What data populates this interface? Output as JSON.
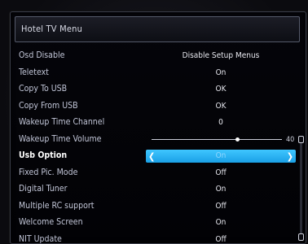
{
  "menu": {
    "title": "Hotel TV Menu",
    "items": [
      {
        "label": "Osd Disable",
        "value": "Disable Setup Menus"
      },
      {
        "label": "Teletext",
        "value": "On"
      },
      {
        "label": "Copy To USB",
        "value": "OK"
      },
      {
        "label": "Copy From USB",
        "value": "OK"
      },
      {
        "label": "Wakeup Time Channel",
        "value": "0"
      },
      {
        "label": "Wakeup Time Volume",
        "value": "40",
        "level": 0.66
      },
      {
        "label": "Usb Option",
        "value": "On",
        "selected": true
      },
      {
        "label": "Fixed Pic. Mode",
        "value": "Off"
      },
      {
        "label": "Digital Tuner",
        "value": "On"
      },
      {
        "label": "Multiple RC support",
        "value": "Off"
      },
      {
        "label": "Welcome Screen",
        "value": "On"
      },
      {
        "label": "NIT Update",
        "value": "Off"
      }
    ]
  },
  "colors": {
    "accent": "#29b6f6",
    "text": "#e8e9f0",
    "label": "#c2c6d8"
  },
  "icons": {
    "left": "chevron-left-icon",
    "right": "chevron-right-icon"
  }
}
